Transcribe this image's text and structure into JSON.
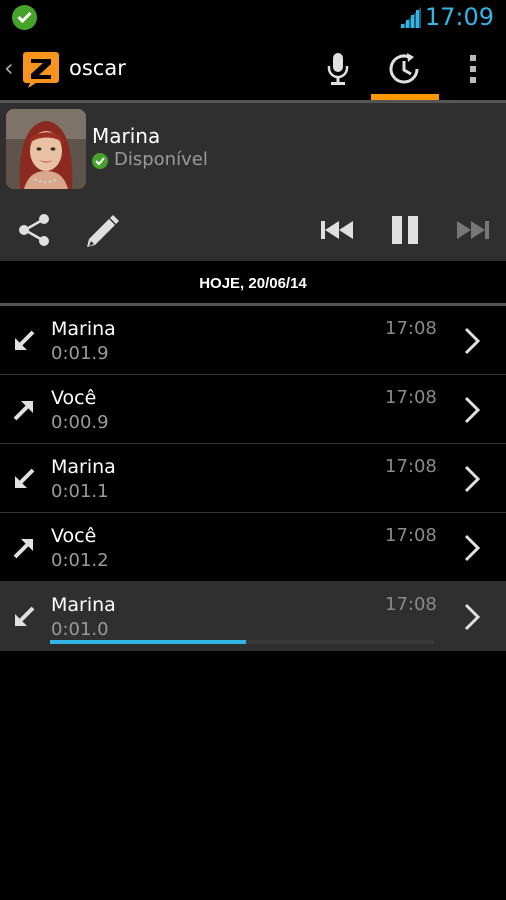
{
  "status_bar": {
    "time": "17:09",
    "notification_icon": "green-check-icon",
    "signal_icon": "signal-strength-icon"
  },
  "action_bar": {
    "back_icon": "chevron-left-icon",
    "app_logo": "zello-logo",
    "title": "oscar",
    "actions": [
      {
        "icon": "microphone-icon"
      },
      {
        "icon": "history-icon",
        "selected": true
      },
      {
        "icon": "overflow-menu-icon"
      }
    ]
  },
  "contact": {
    "name": "Marina",
    "status": "Disponível",
    "status_color": "#46a32a"
  },
  "controls": {
    "share_icon": "share-icon",
    "edit_icon": "pencil-icon",
    "prev_icon": "skip-previous-icon",
    "pause_icon": "pause-icon",
    "next_icon": "skip-next-icon"
  },
  "date_header": "HOJE, 20/06/14",
  "messages": [
    {
      "direction": "incoming",
      "sender": "Marina",
      "duration": "0:01.9",
      "time": "17:08"
    },
    {
      "direction": "outgoing",
      "sender": "Você",
      "duration": "0:00.9",
      "time": "17:08"
    },
    {
      "direction": "incoming",
      "sender": "Marina",
      "duration": "0:01.1",
      "time": "17:08"
    },
    {
      "direction": "outgoing",
      "sender": "Você",
      "duration": "0:01.2",
      "time": "17:08"
    },
    {
      "direction": "incoming",
      "sender": "Marina",
      "duration": "0:01.0",
      "time": "17:08",
      "playing": true,
      "progress": 0.51
    }
  ],
  "colors": {
    "accent": "#33b5e5",
    "tab_indicator": "#ff9800",
    "logo": "#f7941d"
  }
}
